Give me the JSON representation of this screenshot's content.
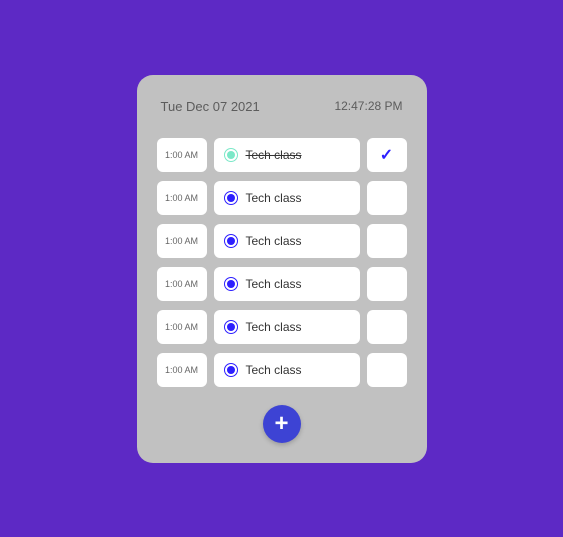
{
  "header": {
    "date": "Tue Dec 07 2021",
    "time": "12:47:28 PM"
  },
  "tasks": [
    {
      "time": "1:00 AM",
      "label": "Tech class",
      "done": true,
      "checked": true
    },
    {
      "time": "1:00 AM",
      "label": "Tech class",
      "done": false,
      "checked": false
    },
    {
      "time": "1:00 AM",
      "label": "Tech class",
      "done": false,
      "checked": false
    },
    {
      "time": "1:00 AM",
      "label": "Tech class",
      "done": false,
      "checked": false
    },
    {
      "time": "1:00 AM",
      "label": "Tech class",
      "done": false,
      "checked": false
    },
    {
      "time": "1:00 AM",
      "label": "Tech class",
      "done": false,
      "checked": false
    }
  ]
}
